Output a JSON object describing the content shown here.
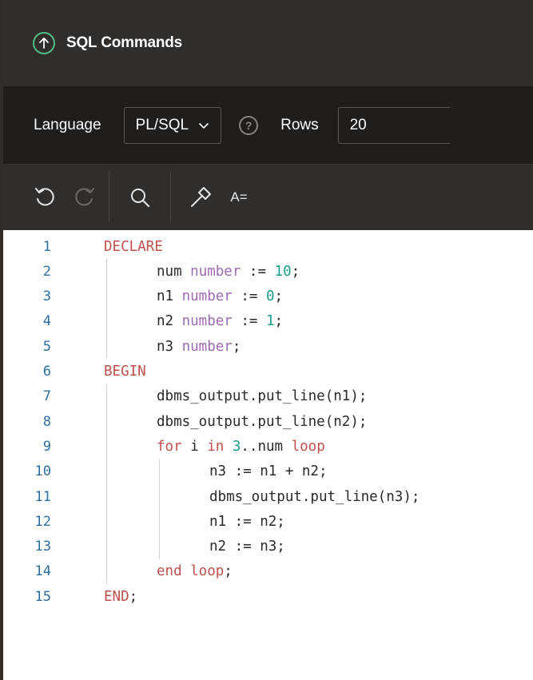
{
  "header": {
    "title": "SQL Commands",
    "icon": "arrow-up-circle-icon",
    "accent_color": "#4fbf8a"
  },
  "settings": {
    "language_label": "Language",
    "language_value": "PL/SQL",
    "rows_label": "Rows",
    "rows_value": "20"
  },
  "toolbar": {
    "buttons": [
      "undo-icon",
      "redo-icon",
      "search-icon",
      "hammer-icon",
      "text-format-icon"
    ],
    "format_label": "A="
  },
  "editor": {
    "lines": [
      {
        "num": "1",
        "indent": 0,
        "tokens": [
          [
            "kw",
            "DECLARE"
          ]
        ]
      },
      {
        "num": "2",
        "indent": 1,
        "tokens": [
          [
            "p",
            "num "
          ],
          [
            "ty",
            "number"
          ],
          [
            "p",
            " := "
          ],
          [
            "nm",
            "10"
          ],
          [
            "p",
            ";"
          ]
        ]
      },
      {
        "num": "3",
        "indent": 1,
        "tokens": [
          [
            "p",
            "n1 "
          ],
          [
            "ty",
            "number"
          ],
          [
            "p",
            " := "
          ],
          [
            "nm",
            "0"
          ],
          [
            "p",
            ";"
          ]
        ]
      },
      {
        "num": "4",
        "indent": 1,
        "tokens": [
          [
            "p",
            "n2 "
          ],
          [
            "ty",
            "number"
          ],
          [
            "p",
            " := "
          ],
          [
            "nm",
            "1"
          ],
          [
            "p",
            ";"
          ]
        ]
      },
      {
        "num": "5",
        "indent": 1,
        "tokens": [
          [
            "p",
            "n3 "
          ],
          [
            "ty",
            "number"
          ],
          [
            "p",
            ";"
          ]
        ]
      },
      {
        "num": "6",
        "indent": 0,
        "tokens": [
          [
            "kw",
            "BEGIN"
          ]
        ]
      },
      {
        "num": "7",
        "indent": 1,
        "tokens": [
          [
            "p",
            "dbms_output.put_line(n1);"
          ]
        ]
      },
      {
        "num": "8",
        "indent": 1,
        "tokens": [
          [
            "p",
            "dbms_output.put_line(n2);"
          ]
        ]
      },
      {
        "num": "9",
        "indent": 1,
        "tokens": [
          [
            "kw",
            "for"
          ],
          [
            "p",
            " i "
          ],
          [
            "kw",
            "in"
          ],
          [
            "p",
            " "
          ],
          [
            "nm",
            "3"
          ],
          [
            "p",
            "..num "
          ],
          [
            "kw",
            "loop"
          ]
        ]
      },
      {
        "num": "10",
        "indent": 2,
        "tokens": [
          [
            "p",
            "n3 := n1 + n2;"
          ]
        ]
      },
      {
        "num": "11",
        "indent": 2,
        "tokens": [
          [
            "p",
            "dbms_output.put_line(n3);"
          ]
        ]
      },
      {
        "num": "12",
        "indent": 2,
        "tokens": [
          [
            "p",
            "n1 := n2;"
          ]
        ]
      },
      {
        "num": "13",
        "indent": 2,
        "tokens": [
          [
            "p",
            "n2 := n3;"
          ]
        ]
      },
      {
        "num": "14",
        "indent": 1,
        "tokens": [
          [
            "kw",
            "end loop"
          ],
          [
            "p",
            ";"
          ]
        ]
      },
      {
        "num": "15",
        "indent": 0,
        "tokens": [
          [
            "kw",
            "END"
          ],
          [
            "p",
            ";"
          ]
        ]
      }
    ]
  }
}
